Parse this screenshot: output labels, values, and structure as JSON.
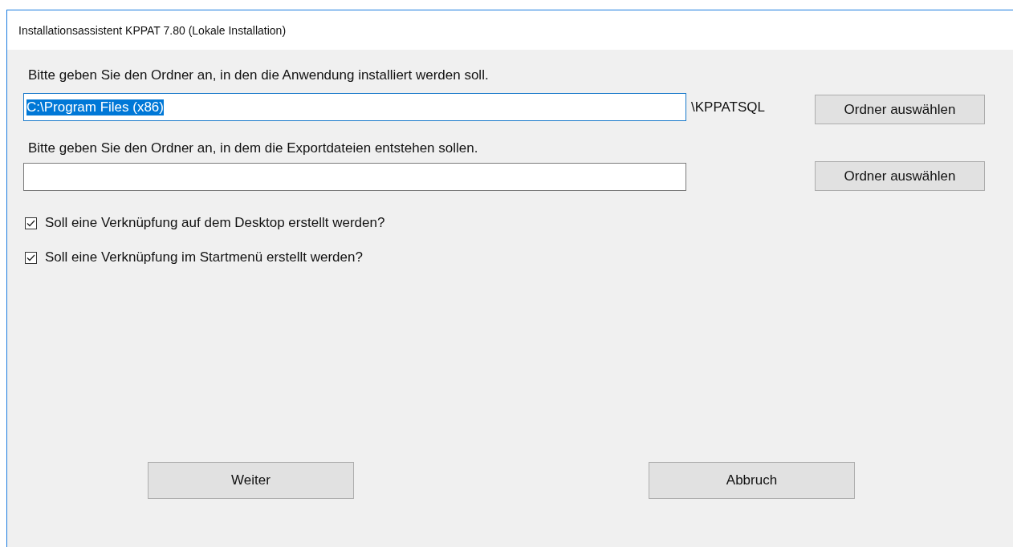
{
  "window": {
    "title": "Installationsassistent KPPAT 7.80 (Lokale Installation)"
  },
  "install_folder": {
    "label": "Bitte geben Sie den Ordner an, in den die Anwendung installiert werden soll.",
    "value": "C:\\Program Files (x86)",
    "focused": true,
    "suffix": "\\KPPATSQL",
    "button": "Ordner auswählen"
  },
  "export_folder": {
    "label": "Bitte geben Sie den Ordner an, in dem die Exportdateien entstehen sollen.",
    "focused": false,
    "button": "Ordner auswählen"
  },
  "options": [
    {
      "label": "Soll eine Verknüpfung auf dem Desktop erstellt werden?",
      "checked": true
    },
    {
      "label": "Soll eine Verknüpfung im Startmenü erstellt werden?",
      "checked": true
    }
  ],
  "buttons": [
    "Weiter",
    "Abbruch"
  ]
}
